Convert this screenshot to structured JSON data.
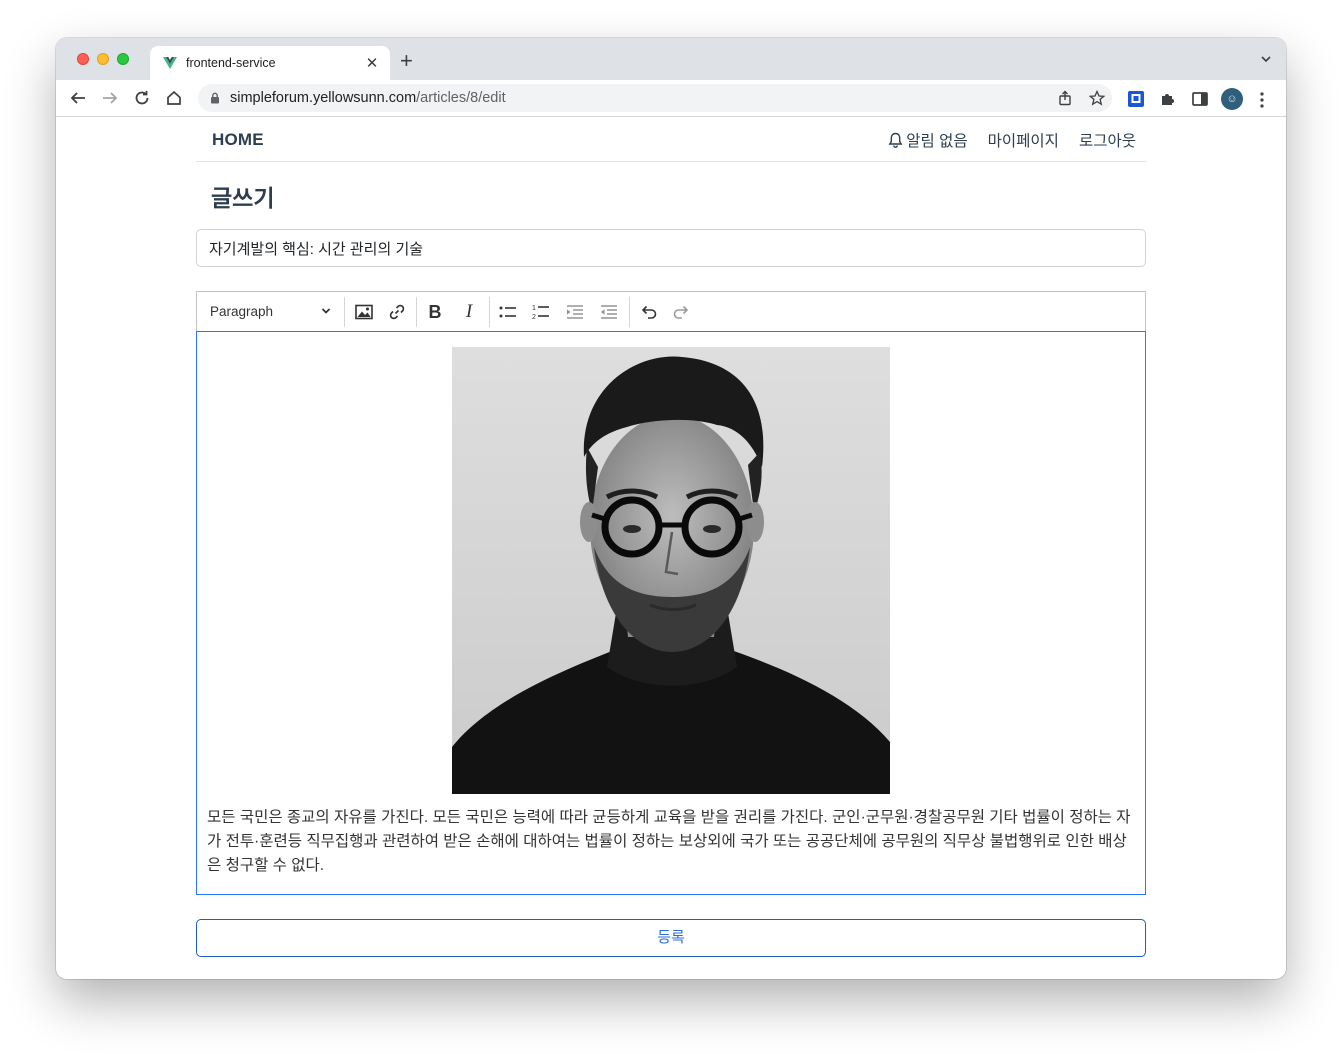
{
  "browser": {
    "tab_title": "frontend-service",
    "url_host": "simpleforum.yellowsunn.com",
    "url_path": "/articles/8/edit",
    "profile_initial": "☺"
  },
  "navbar": {
    "brand": "HOME",
    "notification_label": "알림 없음",
    "mypage_label": "마이페이지",
    "logout_label": "로그아웃"
  },
  "main": {
    "page_title": "글쓰기",
    "title_value": "자기계발의 핵심: 시간 관리의 기술"
  },
  "editor": {
    "heading_select": "Paragraph",
    "toolbar_buttons": [
      "image",
      "link",
      "bold",
      "italic",
      "bulleted-list",
      "numbered-list",
      "indent",
      "outdent",
      "undo",
      "redo"
    ],
    "body_text": "모든 국민은 종교의 자유를 가진다. 모든 국민은 능력에 따라 균등하게 교육을 받을 권리를 가진다. 군인·군무원·경찰공무원 기타 법률이 정하는 자가 전투·훈련등 직무집행과 관련하여 받은 손해에 대하여는 법률이 정하는 보상외에 국가 또는 공공단체에 공무원의 직무상 불법행위로 인한 배상은 청구할 수 없다."
  },
  "submit": {
    "label": "등록"
  },
  "colors": {
    "accent": "#2d6fd1",
    "editor_focus_border": "#2977ff",
    "text_dark": "#2c3e50"
  }
}
